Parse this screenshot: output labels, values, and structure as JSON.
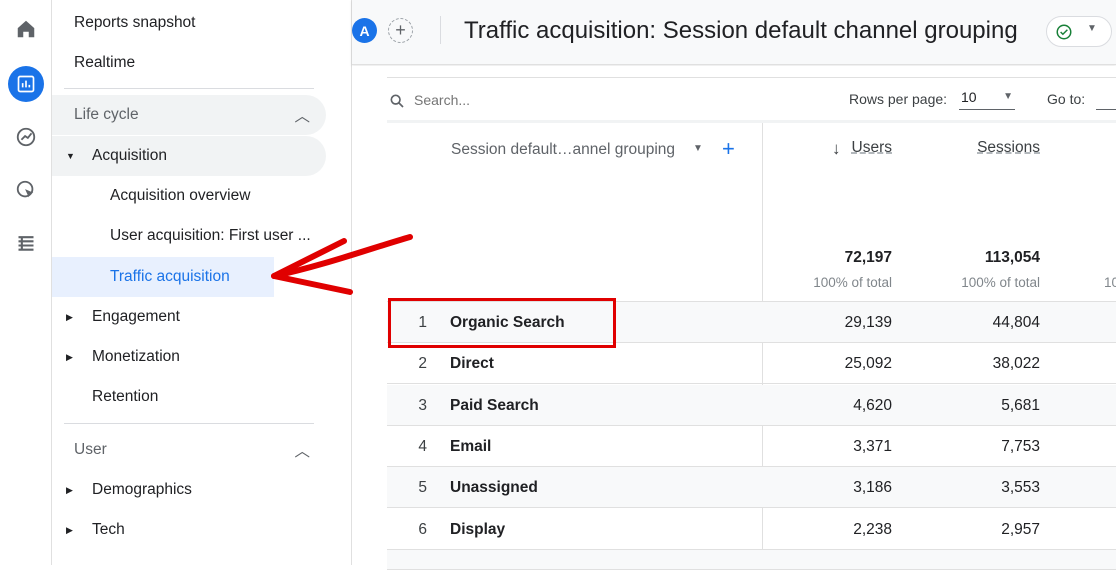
{
  "rail": {
    "icons": [
      "home-icon",
      "reports-icon",
      "explore-icon",
      "advertising-icon",
      "configure-icon"
    ]
  },
  "sidebar": {
    "reports_snapshot": "Reports snapshot",
    "realtime": "Realtime",
    "life_cycle": "Life cycle",
    "acquisition": "Acquisition",
    "acquisition_overview": "Acquisition overview",
    "user_acquisition": "User acquisition: First user ...",
    "traffic_acquisition": "Traffic acquisition",
    "engagement": "Engagement",
    "monetization": "Monetization",
    "retention": "Retention",
    "user": "User",
    "demographics": "Demographics",
    "tech": "Tech"
  },
  "header": {
    "avatar": "A",
    "title": "Traffic acquisition: Session default channel grouping"
  },
  "toolbar": {
    "search_placeholder": "Search...",
    "rows_per_page_label": "Rows per page:",
    "rows_per_page": "10",
    "go_to_label": "Go to:"
  },
  "table": {
    "dimension_header": "Session default…annel grouping",
    "columns": [
      "Users",
      "Sessions"
    ],
    "totals": [
      "72,197",
      "113,054"
    ],
    "totals_sub": "100% of total",
    "totals_sub_partial": "10",
    "rows": [
      {
        "n": "1",
        "channel": "Organic Search",
        "users": "29,139",
        "sessions": "44,804"
      },
      {
        "n": "2",
        "channel": "Direct",
        "users": "25,092",
        "sessions": "38,022"
      },
      {
        "n": "3",
        "channel": "Paid Search",
        "users": "4,620",
        "sessions": "5,681"
      },
      {
        "n": "4",
        "channel": "Email",
        "users": "3,371",
        "sessions": "7,753"
      },
      {
        "n": "5",
        "channel": "Unassigned",
        "users": "3,186",
        "sessions": "3,553"
      },
      {
        "n": "6",
        "channel": "Display",
        "users": "2,238",
        "sessions": "2,957"
      }
    ]
  },
  "annotation": {
    "color": "#e00000"
  },
  "colors": {
    "accent": "#1a73e8",
    "highlight": "#e8f0fe"
  }
}
